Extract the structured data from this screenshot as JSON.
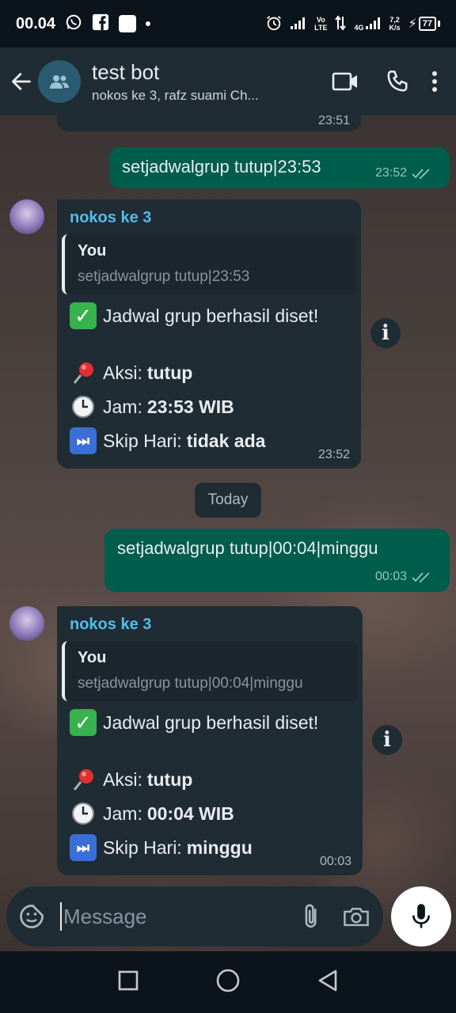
{
  "status_bar": {
    "time": "00.04",
    "volte_top": "Vo",
    "volte_bottom": "LTE",
    "network": "4G",
    "speed_top": "7,2",
    "speed_bottom": "K/s",
    "battery": "77"
  },
  "header": {
    "title": "test bot",
    "subtitle": "nokos ke 3, rafz suami Ch..."
  },
  "messages": {
    "partial_top_time": "23:51",
    "out1": {
      "text": "setjadwalgrup tutup|23:53",
      "time": "23:52"
    },
    "in1": {
      "sender": "nokos ke 3",
      "quote_author": "You",
      "quote_text": "setjadwalgrup tutup|23:53",
      "line1": "Jadwal grup berhasil diset!",
      "aksi_label": "Aksi:",
      "aksi_value": "tutup",
      "jam_label": "Jam:",
      "jam_value": "23:53 WIB",
      "skip_label": "Skip Hari:",
      "skip_value": "tidak ada",
      "time": "23:52"
    },
    "date_chip": "Today",
    "out2": {
      "text": "setjadwalgrup tutup|00:04|minggu",
      "time": "00:03"
    },
    "in2": {
      "sender": "nokos ke 3",
      "quote_author": "You",
      "quote_text": "setjadwalgrup tutup|00:04|minggu",
      "line1": "Jadwal grup berhasil diset!",
      "aksi_label": "Aksi:",
      "aksi_value": "tutup",
      "jam_label": "Jam:",
      "jam_value": "00:04 WIB",
      "skip_label": "Skip Hari:",
      "skip_value": "minggu",
      "time": "00:03"
    }
  },
  "input": {
    "placeholder": "Message"
  }
}
